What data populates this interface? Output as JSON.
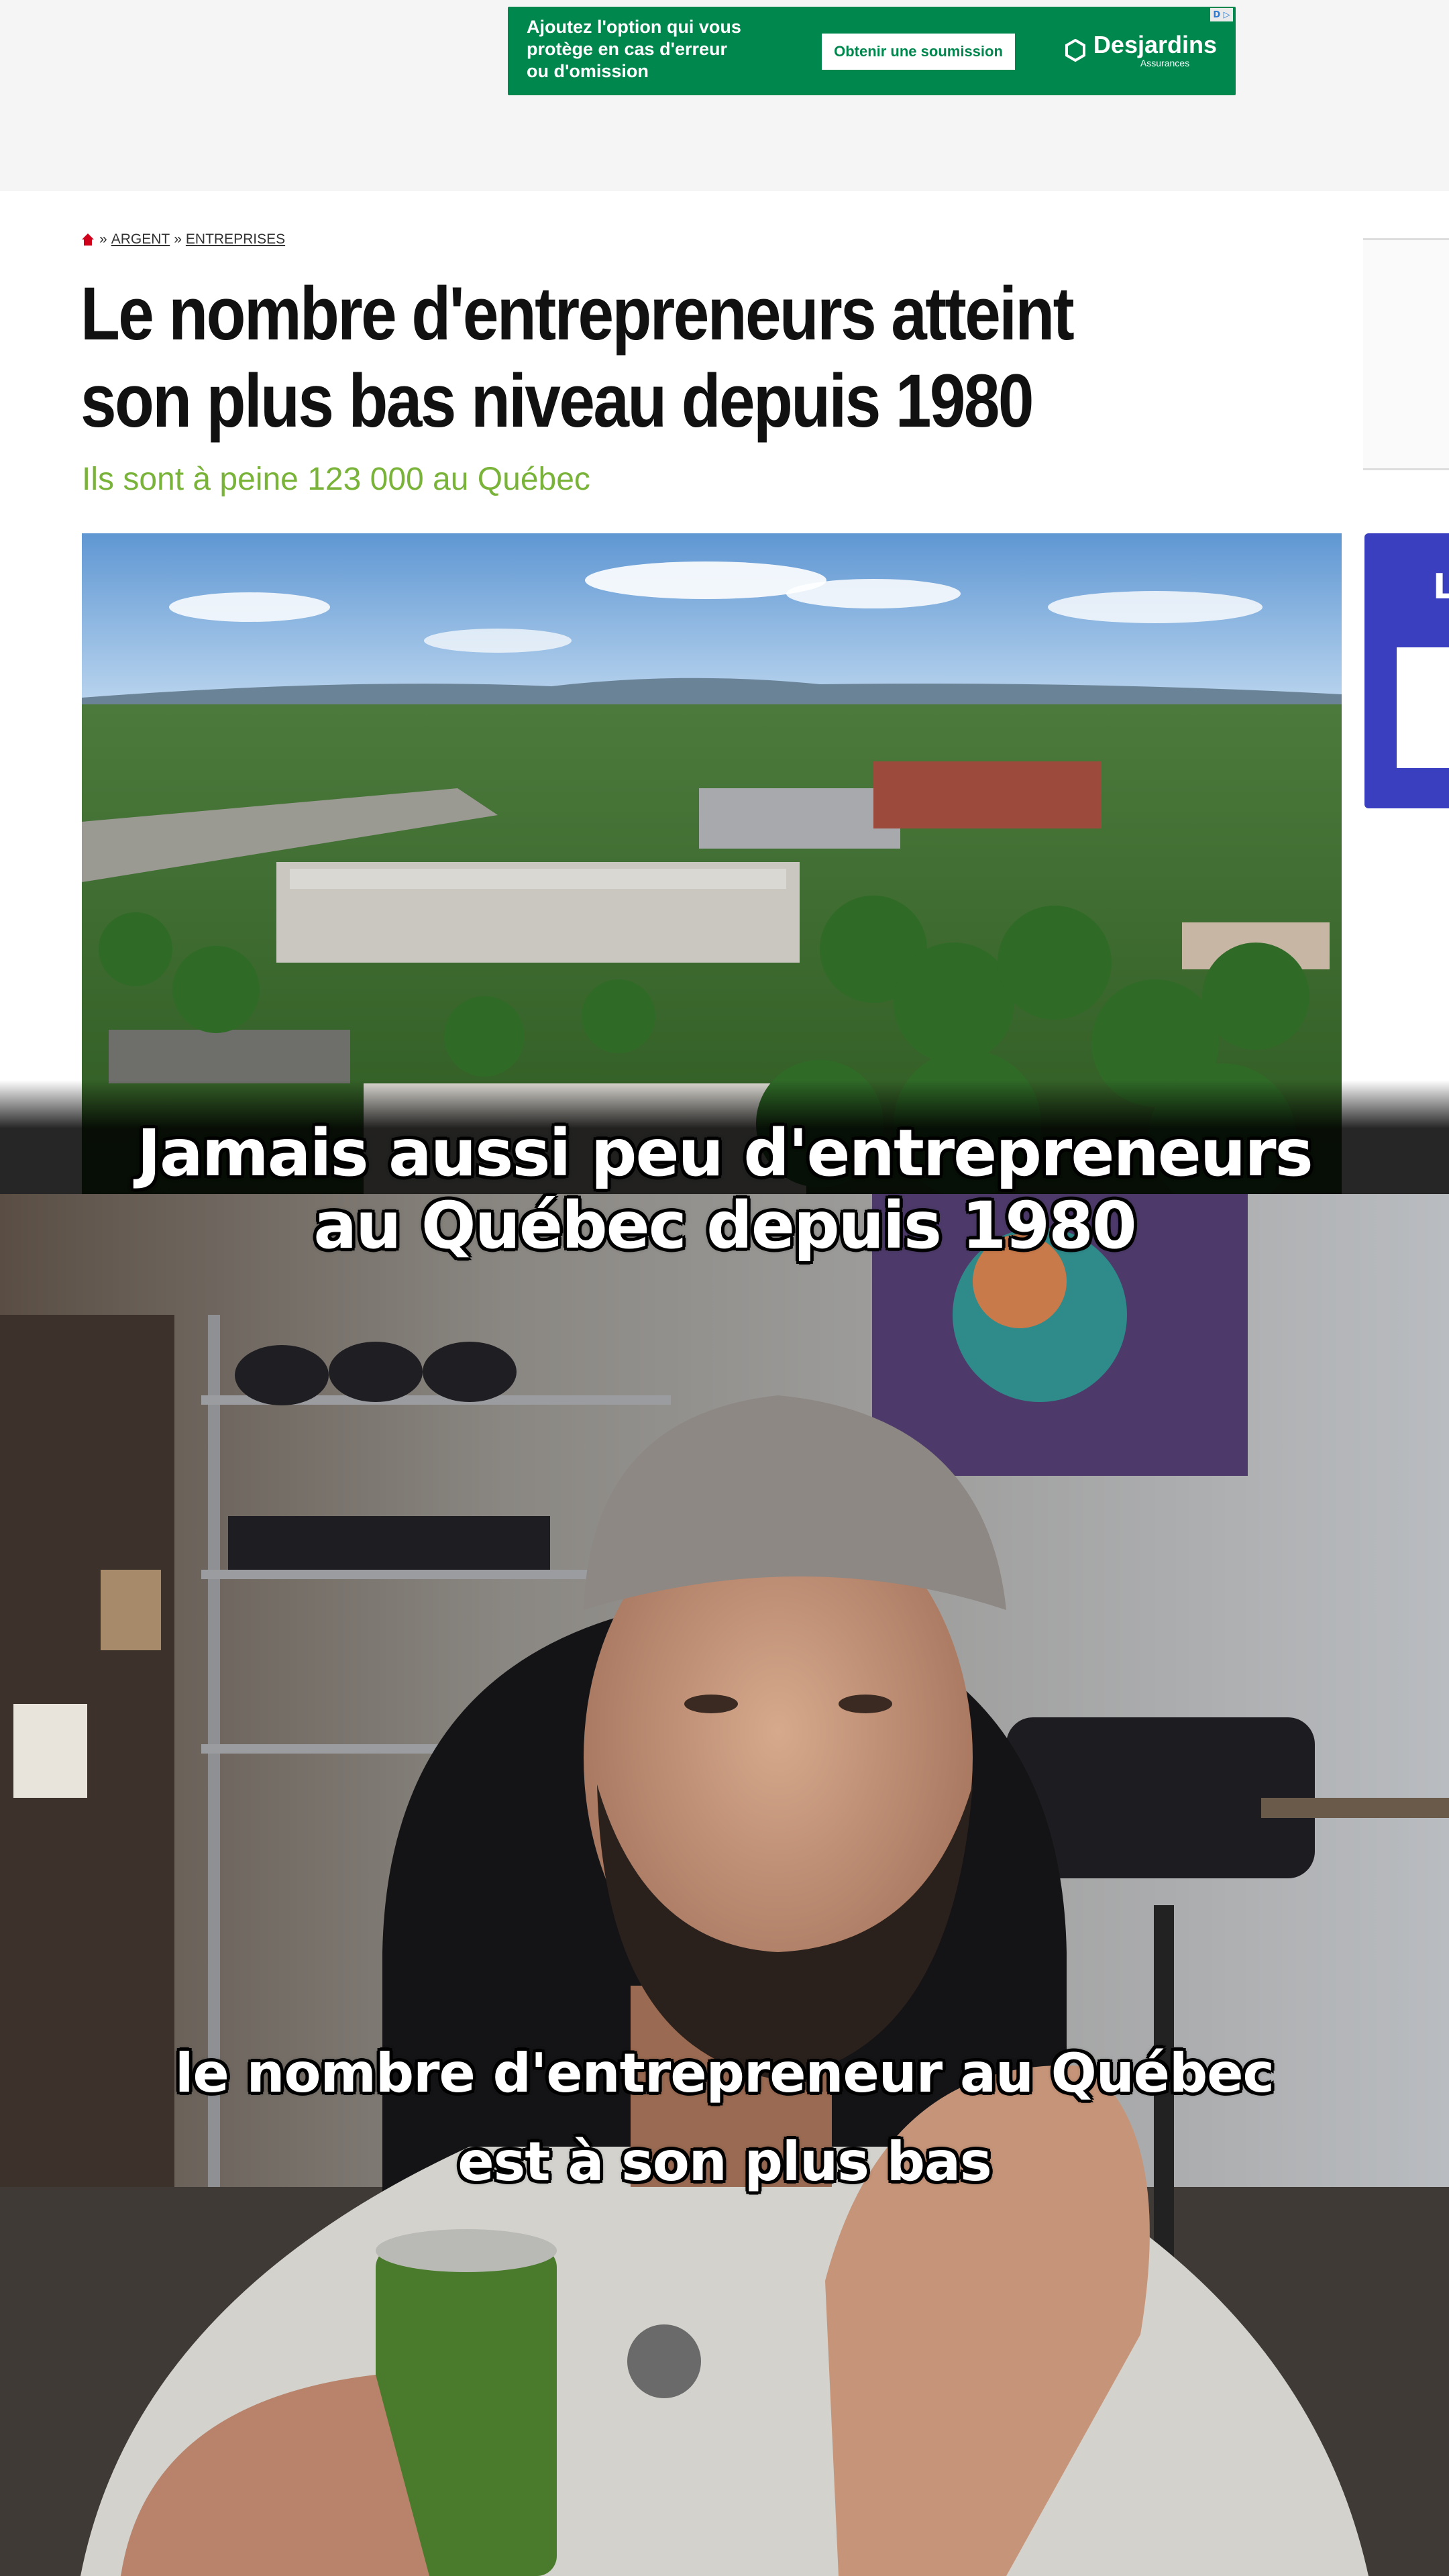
{
  "ad": {
    "text": "Ajoutez l'option qui vous\nprotège en cas d'erreur\nou d'omission",
    "button_label": "Obtenir une soumission",
    "brand": "Desjardins",
    "brand_sub": "Assurances",
    "badge": "D ▷",
    "color": "#00874e"
  },
  "article": {
    "breadcrumb": [
      "ARGENT",
      "ENTREPRISES"
    ],
    "breadcrumb_separator": "»",
    "headline": "Le nombre d'entrepreneurs atteint\nson plus bas niveau depuis 1980",
    "subheadline": "Ils sont à peine 123 000 au Québec",
    "subheadline_color": "#7ab33a",
    "rail_letter": "L"
  },
  "captions": {
    "top": "Jamais aussi peu d'entrepreneurs\nau Québec depuis 1980",
    "bottom": "le nombre d'entrepreneur au Québec\nest à son plus bas"
  },
  "icons": {
    "home": "home-icon",
    "brand_logo": "desjardins-logo-icon"
  }
}
